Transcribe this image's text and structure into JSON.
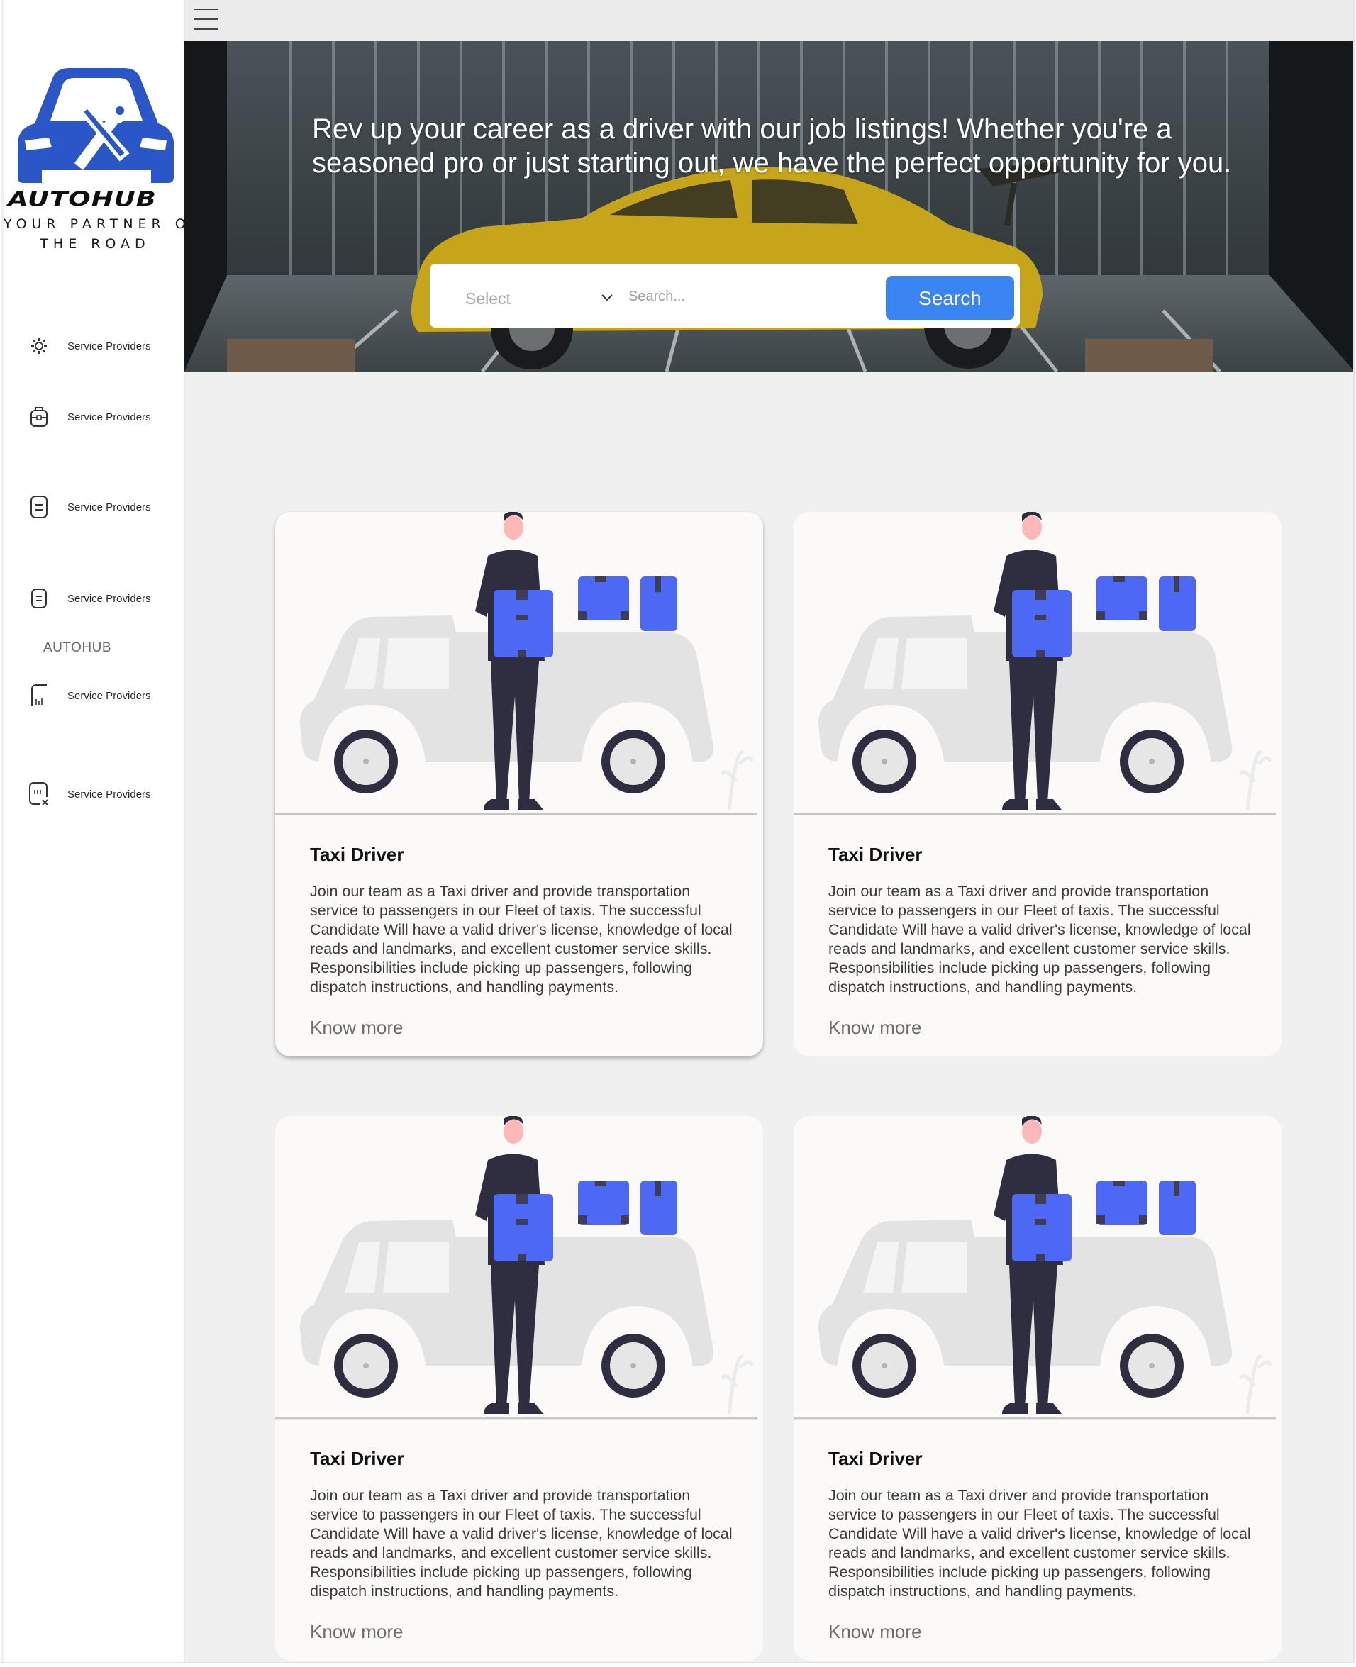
{
  "brand": {
    "name": "AUTOHUB",
    "tagline_line1": "YOUR PARTNER O",
    "tagline_line2": "THE ROAD",
    "logo_color": "#2b56c7"
  },
  "sidebar": {
    "items": [
      {
        "label": "Service Providers",
        "icon": "settings-cog-icon"
      },
      {
        "label": "Service Providers",
        "icon": "toolbox-icon"
      },
      {
        "label": "Service Providers",
        "icon": "document-icon"
      },
      {
        "label": "Service Providers",
        "icon": "document-icon"
      },
      {
        "label": "Service Providers",
        "icon": "chart-icon"
      },
      {
        "label": "Service Providers",
        "icon": "clipboard-x-icon"
      }
    ],
    "section_label": "AUTOHUB"
  },
  "hero": {
    "headline": "Rev up your career as a driver with our job listings! Whether you're a seasoned pro or just starting out, we have the perfect opportunity for you.",
    "select_label": "Select",
    "search_placeholder": "Search...",
    "search_button": "Search",
    "accent": "#3a84f3"
  },
  "cards": [
    {
      "title": "Taxi Driver",
      "description": "Join our team as a Taxi driver and provide transportation service to passengers in our Fleet of taxis. The successful Candidate Will have a valid driver's license, knowledge of local reads and landmarks, and excellent customer service skills. Responsibilities include picking up passengers, following dispatch instructions, and handling payments.",
      "link": "Know more"
    },
    {
      "title": "Taxi Driver",
      "description": "Join our team as a Taxi driver and provide transportation service to passengers in our Fleet of taxis. The successful Candidate Will have a valid driver's license, knowledge of local reads and landmarks, and excellent customer service skills. Responsibilities include picking up passengers, following dispatch instructions, and handling payments.",
      "link": "Know more"
    },
    {
      "title": "Taxi Driver",
      "description": "Join our team as a Taxi driver and provide transportation service to passengers in our Fleet of taxis. The successful Candidate Will have a valid driver's license, knowledge of local reads and landmarks, and excellent customer service skills. Responsibilities include picking up passengers, following dispatch instructions, and handling payments.",
      "link": "Know more"
    },
    {
      "title": "Taxi Driver",
      "description": "Join our team as a Taxi driver and provide transportation service to passengers in our Fleet of taxis. The successful Candidate Will have a valid driver's license, knowledge of local reads and landmarks, and excellent customer service skills. Responsibilities include picking up passengers, following dispatch instructions, and handling payments.",
      "link": "Know more"
    }
  ]
}
